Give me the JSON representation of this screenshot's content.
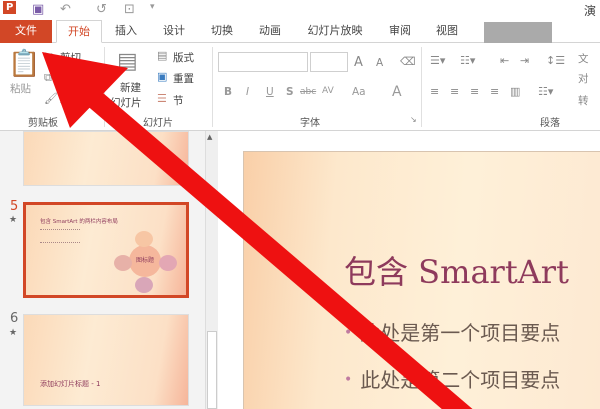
{
  "titlebar": {
    "app_icon": "P",
    "title_partial": "演"
  },
  "tabs": [
    "文件",
    "开始",
    "插入",
    "设计",
    "切换",
    "动画",
    "幻灯片放映",
    "审阅",
    "视图"
  ],
  "clipboard": {
    "paste": "粘贴",
    "cut": "剪切",
    "format_painter": "格式刷",
    "label": "剪贴板"
  },
  "slides_group": {
    "new_slide_1": "新建",
    "new_slide_2": "幻灯片",
    "layout": "版式",
    "reset": "重置",
    "section": "节",
    "label": "幻灯片"
  },
  "font_group": {
    "label": "字体",
    "bold": "B",
    "italic": "I",
    "underline": "U",
    "shadow": "S",
    "strike": "abc",
    "spacing": "AV",
    "case": "Aa",
    "color": "A",
    "grow": "A",
    "shrink": "A"
  },
  "paragraph_group": {
    "label": "段落",
    "text_dir": "文",
    "align_text": "对",
    "convert": "转"
  },
  "thumbnails": [
    {
      "number": "5",
      "title": "包含 SmartArt 的两栏内容布局",
      "center": "图标题",
      "selected": true
    },
    {
      "number": "6",
      "title": "添加幻灯片标题 - 1",
      "selected": false
    }
  ],
  "slide": {
    "title": "包含 SmartArt",
    "bullets": [
      "此处是第一个项目要点",
      "此处是第二个项目要点"
    ]
  },
  "colors": {
    "accent": "#d24726",
    "arrow": "#ee1111"
  }
}
